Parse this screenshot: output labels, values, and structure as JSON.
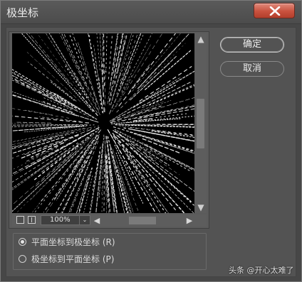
{
  "window": {
    "title": "极坐标",
    "close_label": "✕"
  },
  "preview": {
    "zoom": "100%",
    "zoom_dropdown": "⌄",
    "scroll_up": "▲",
    "scroll_down": "▼",
    "scroll_left": "◀",
    "scroll_right": "▶"
  },
  "buttons": {
    "ok": "确定",
    "cancel": "取消"
  },
  "options": [
    {
      "label": "平面坐标到极坐标 (R)",
      "selected": true
    },
    {
      "label": "极坐标到平面坐标 (P)",
      "selected": false
    }
  ],
  "watermark": "头条 @开心太难了"
}
